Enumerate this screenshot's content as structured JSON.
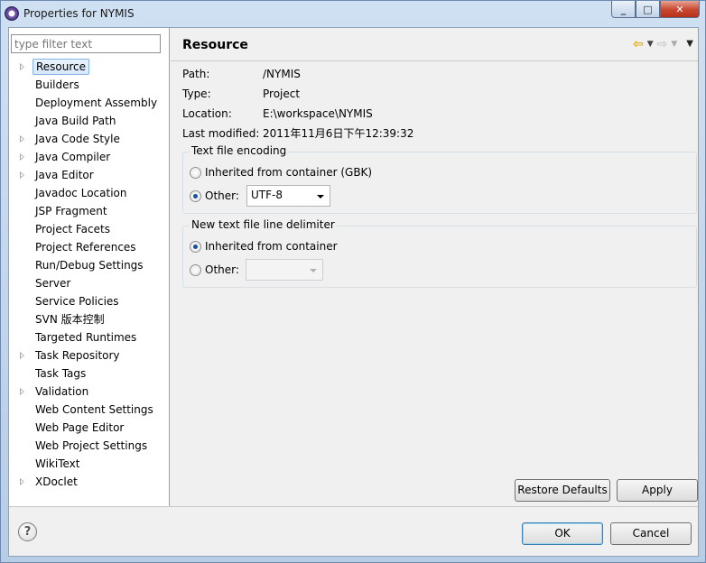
{
  "window": {
    "title": "Properties for NYMIS",
    "minimize": "_",
    "maximize": "□",
    "close": "✕"
  },
  "sidebar": {
    "filter_placeholder": "type filter text",
    "items": [
      {
        "label": "Resource",
        "expandable": true,
        "selected": true
      },
      {
        "label": "Builders",
        "expandable": false
      },
      {
        "label": "Deployment Assembly",
        "expandable": false
      },
      {
        "label": "Java Build Path",
        "expandable": false
      },
      {
        "label": "Java Code Style",
        "expandable": true
      },
      {
        "label": "Java Compiler",
        "expandable": true
      },
      {
        "label": "Java Editor",
        "expandable": true
      },
      {
        "label": "Javadoc Location",
        "expandable": false
      },
      {
        "label": "JSP Fragment",
        "expandable": false
      },
      {
        "label": "Project Facets",
        "expandable": false
      },
      {
        "label": "Project References",
        "expandable": false
      },
      {
        "label": "Run/Debug Settings",
        "expandable": false
      },
      {
        "label": "Server",
        "expandable": false
      },
      {
        "label": "Service Policies",
        "expandable": false
      },
      {
        "label": "SVN 版本控制",
        "expandable": false
      },
      {
        "label": "Targeted Runtimes",
        "expandable": false
      },
      {
        "label": "Task Repository",
        "expandable": true
      },
      {
        "label": "Task Tags",
        "expandable": false
      },
      {
        "label": "Validation",
        "expandable": true
      },
      {
        "label": "Web Content Settings",
        "expandable": false
      },
      {
        "label": "Web Page Editor",
        "expandable": false
      },
      {
        "label": "Web Project Settings",
        "expandable": false
      },
      {
        "label": "WikiText",
        "expandable": false
      },
      {
        "label": "XDoclet",
        "expandable": true
      }
    ]
  },
  "page": {
    "title": "Resource",
    "properties": [
      {
        "key": "Path:",
        "value": "/NYMIS"
      },
      {
        "key": "Type:",
        "value": "Project"
      },
      {
        "key": "Location:",
        "value": "E:\\workspace\\NYMIS"
      },
      {
        "key": "Last modified:",
        "value": "2011年11月6日下午12:39:32"
      }
    ],
    "encoding": {
      "legend": "Text file encoding",
      "inherited_label": "Inherited from container (GBK)",
      "other_label": "Other:",
      "selected": "other",
      "other_value": "UTF-8"
    },
    "delimiter": {
      "legend": "New text file line delimiter",
      "inherited_label": "Inherited from container",
      "other_label": "Other:",
      "selected": "inherited",
      "other_value": ""
    },
    "restore_defaults": "Restore Defaults",
    "apply": "Apply"
  },
  "footer": {
    "help": "?",
    "ok": "OK",
    "cancel": "Cancel"
  },
  "colors": {
    "accent": "#1b4f9a",
    "selection_border": "#85b3e6",
    "back_arrow": "#e0a900"
  }
}
